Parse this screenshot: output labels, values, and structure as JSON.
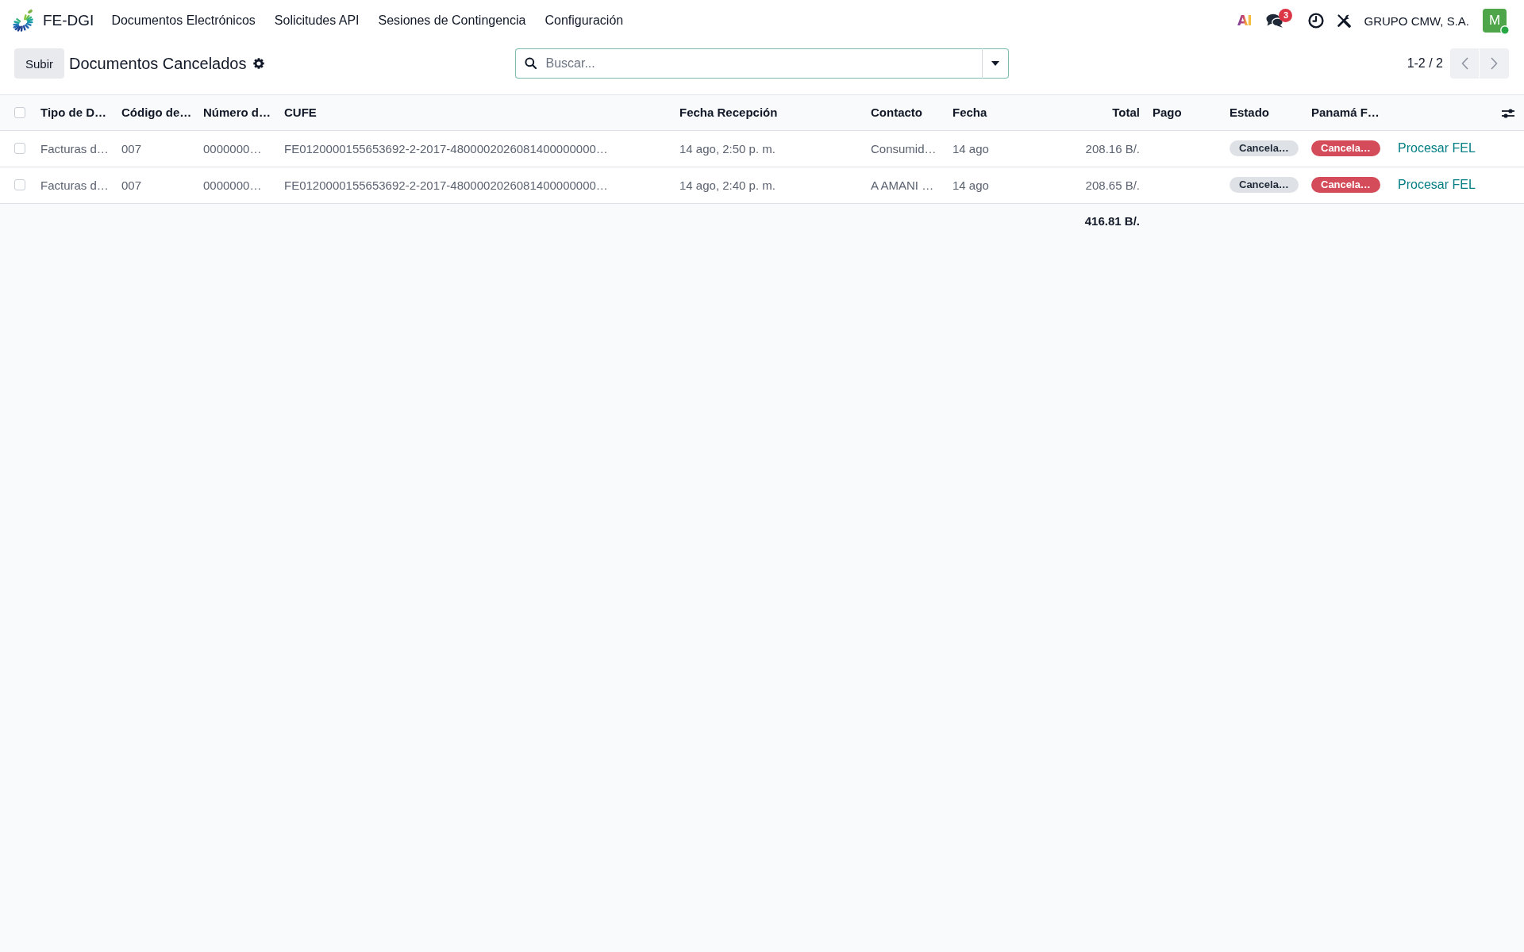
{
  "navbar": {
    "app_name": "FE-DGI",
    "menu": [
      "Documentos Electrónicos",
      "Solicitudes API",
      "Sesiones de Contingencia",
      "Configuración"
    ],
    "systray": {
      "ai_label": "AI",
      "messages_badge": "3",
      "company": "GRUPO CMW, S.A.",
      "avatar": {
        "initial": "M",
        "online": true
      }
    }
  },
  "control_panel": {
    "upload_button": "Subir",
    "title": "Documentos Cancelados",
    "search": {
      "placeholder": "Buscar..."
    },
    "pager": "1-2 / 2"
  },
  "table": {
    "select_all": {
      "checked": false
    },
    "columns": [
      {
        "label": "Tipo de D…",
        "kind": "text"
      },
      {
        "label": "Código de…",
        "kind": "text"
      },
      {
        "label": "Número d…",
        "kind": "text"
      },
      {
        "label": "CUFE",
        "kind": "text"
      },
      {
        "label": "Fecha Recepción",
        "kind": "text"
      },
      {
        "label": "Contacto",
        "kind": "text"
      },
      {
        "label": "Fecha",
        "kind": "text"
      },
      {
        "label": "Total",
        "kind": "number",
        "sum": "416.81 B/."
      },
      {
        "label": "Pago",
        "kind": "text"
      },
      {
        "label": "Estado",
        "kind": "badge"
      },
      {
        "label": "Panamá F…",
        "kind": "badge"
      },
      {
        "kind": "button"
      }
    ],
    "rows": [
      {
        "checked": false,
        "cells": [
          "Facturas d…",
          "007",
          "0000000…",
          "FE0120000155653692-2-2017-4800002026081400000000…",
          "14 ago, 2:50 p. m.",
          "Consumid…",
          "14 ago",
          "208.16 B/.",
          null,
          {
            "text": "Cancela…",
            "color": "#dee2e6"
          },
          {
            "text": "Cancela…",
            "color": "#d44c59"
          },
          "Procesar FEL"
        ]
      },
      {
        "checked": false,
        "cells": [
          "Facturas d…",
          "007",
          "0000000…",
          "FE0120000155653692-2-2017-4800002026081400000000…",
          "14 ago, 2:40 p. m.",
          "A AMANI …",
          "14 ago",
          "208.65 B/.",
          null,
          {
            "text": "Cancela…",
            "color": "#dee2e6"
          },
          {
            "text": "Cancela…",
            "color": "#d44c59"
          },
          "Procesar FEL"
        ]
      }
    ]
  }
}
